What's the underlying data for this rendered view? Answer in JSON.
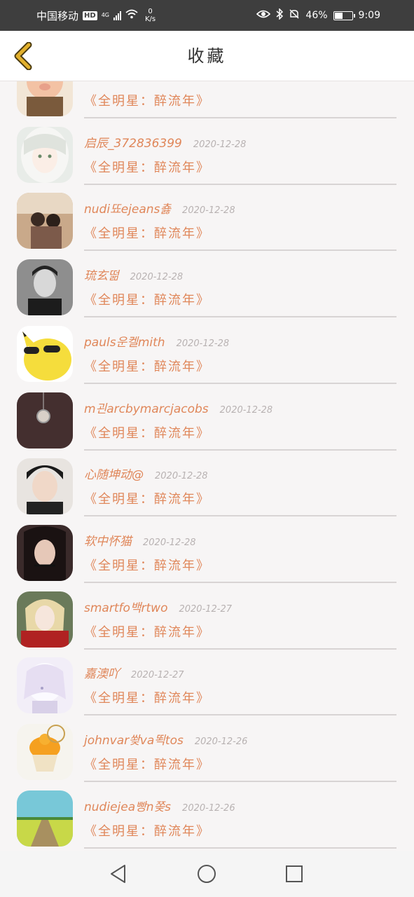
{
  "status_bar": {
    "carrier": "中国移动",
    "hd": "HD",
    "network": "4G",
    "speed_value": "0",
    "speed_unit": "K/s",
    "battery_text": "46%",
    "battery_level": 0.46,
    "time": "9:09"
  },
  "header": {
    "title": "收藏"
  },
  "favorites": [
    {
      "username": "",
      "date": "",
      "game": "《全明星：醉流年》",
      "avatar": "cartoon-pig"
    },
    {
      "username": "启辰_372836399",
      "date": "2020-12-28",
      "game": "《全明星：醉流年》",
      "avatar": "anime-girl-white-hair"
    },
    {
      "username": "nudi뚀ejeans춇",
      "date": "2020-12-28",
      "game": "《全明星：醉流年》",
      "avatar": "couple-photo"
    },
    {
      "username": "琉玄떪",
      "date": "2020-12-28",
      "game": "《全明星：醉流年》",
      "avatar": "man-bw-portrait"
    },
    {
      "username": "pauls운켈mith",
      "date": "2020-12-28",
      "game": "《全明星：醉流年》",
      "avatar": "pikachu-sunglasses"
    },
    {
      "username": "m괸arcbymarcjacobs",
      "date": "2020-12-28",
      "game": "《全明星：醉流年》",
      "avatar": "pocket-watch"
    },
    {
      "username": "心随坤动@",
      "date": "2020-12-28",
      "game": "《全明星：醉流年》",
      "avatar": "young-man-portrait"
    },
    {
      "username": "软中怀猫",
      "date": "2020-12-28",
      "game": "《全明星：醉流年》",
      "avatar": "woman-dark-portrait"
    },
    {
      "username": "smartfo백rtwo",
      "date": "2020-12-27",
      "game": "《全明星：醉流年》",
      "avatar": "blonde-woman"
    },
    {
      "username": "嘉澳吖",
      "date": "2020-12-27",
      "game": "《全明星：醉流年》",
      "avatar": "anime-pastel"
    },
    {
      "username": "johnvar쐊va뙥tos",
      "date": "2020-12-26",
      "game": "《全明星：醉流年》",
      "avatar": "cupcake"
    },
    {
      "username": "nudiejea빵n쫒s",
      "date": "2020-12-26",
      "game": "《全明星：醉流年》",
      "avatar": "field-landscape"
    }
  ],
  "nav_bar": {
    "back_icon": "triangle-back-icon",
    "home_icon": "circle-home-icon",
    "recents_icon": "square-recents-icon"
  },
  "colors": {
    "accent": "#e0875a",
    "date": "#b8b2b2",
    "background": "#f7f5f5",
    "status_bar": "#3e3e3e",
    "back_arrow": "#d9a520"
  }
}
